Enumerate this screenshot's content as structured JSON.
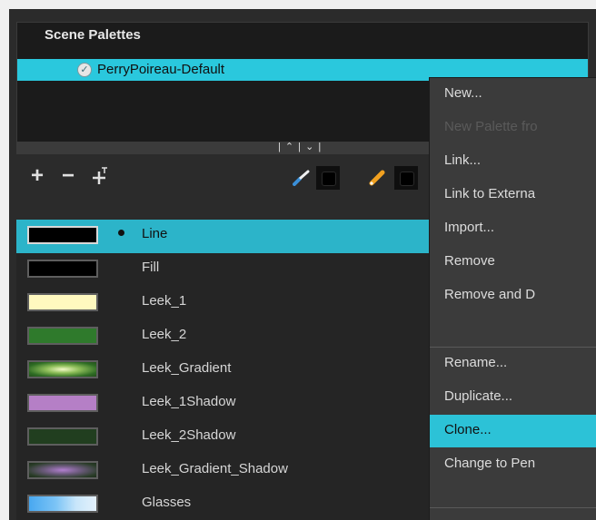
{
  "scene_palettes": {
    "header": "Scene Palettes",
    "selected_palette": "PerryPoireau-Default"
  },
  "toolbar": {
    "add": "+",
    "remove": "−",
    "add_texture": "+"
  },
  "colors": [
    {
      "name": "Line",
      "swatch": "#000000",
      "selected": true
    },
    {
      "name": "Fill",
      "swatch": "#000000"
    },
    {
      "name": "Leek_1",
      "swatch": "#fff9bf"
    },
    {
      "name": "Leek_2",
      "swatch": "#2f7a2c"
    },
    {
      "name": "Leek_Gradient",
      "swatch": "gradient-green"
    },
    {
      "name": "Leek_1Shadow",
      "swatch": "#b57fc6"
    },
    {
      "name": "Leek_2Shadow",
      "swatch": "#213e1f"
    },
    {
      "name": "Leek_Gradient_Shadow",
      "swatch": "gradient-purple"
    },
    {
      "name": "Glasses",
      "swatch": "texture-blue"
    }
  ],
  "menu": {
    "items": [
      {
        "label": "New...",
        "enabled": true
      },
      {
        "label": "New Palette fro",
        "enabled": false
      },
      {
        "label": "Link...",
        "enabled": true
      },
      {
        "label": "Link to Externa",
        "enabled": true
      },
      {
        "label": "Import...",
        "enabled": true
      },
      {
        "label": "Remove",
        "enabled": true
      },
      {
        "label": "Remove and D",
        "enabled": true
      },
      {
        "label": "Rename...",
        "enabled": true
      },
      {
        "label": "Duplicate...",
        "enabled": true
      },
      {
        "label": "Clone...",
        "enabled": true,
        "highlighted": true
      },
      {
        "label": "Change to Pen",
        "enabled": true
      }
    ]
  },
  "colors_accent": {
    "selection": "#2cc2d7",
    "background": "#2b2b2b"
  }
}
